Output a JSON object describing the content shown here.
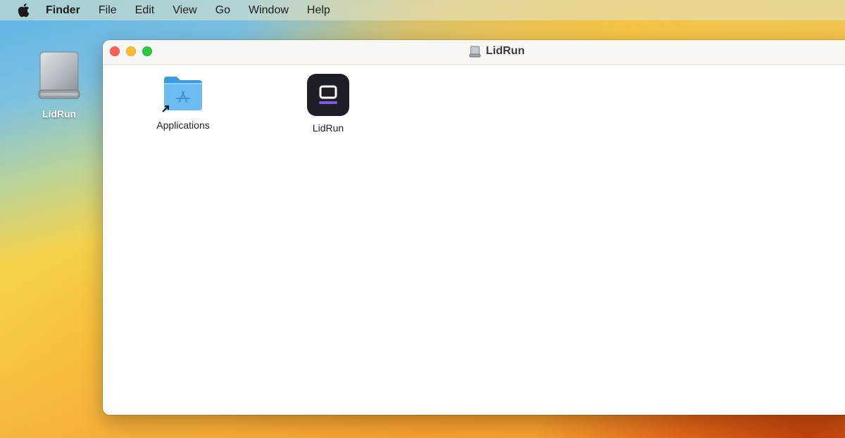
{
  "menubar": {
    "apple_icon": "apple-logo-icon",
    "items": [
      "Finder",
      "File",
      "Edit",
      "View",
      "Go",
      "Window",
      "Help"
    ]
  },
  "desktop": {
    "disk_label": "LidRun",
    "disk_icon": "external-drive-icon"
  },
  "window": {
    "title": "LidRun",
    "title_icon": "drive-icon",
    "items": [
      {
        "label": "Applications",
        "icon": "applications-folder-alias-icon"
      },
      {
        "label": "LidRun",
        "icon": "lidrun-app-icon"
      }
    ]
  },
  "colors": {
    "close": "#ff5f57",
    "minimize": "#febc2e",
    "zoom": "#28c840",
    "folder": "#5aaeea",
    "app_bg": "#1e1e26",
    "app_accent": "#7c5ce6"
  }
}
